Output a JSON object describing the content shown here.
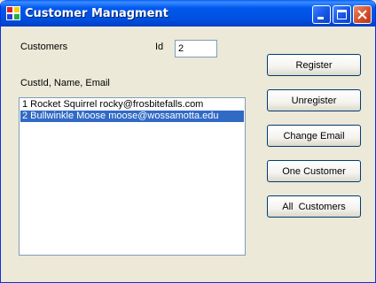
{
  "window": {
    "title": "Customer Managment"
  },
  "labels": {
    "customers": "Customers",
    "id": "Id",
    "columns": "CustId, Name, Email"
  },
  "id_field": {
    "value": "2"
  },
  "customers_list": {
    "items": [
      {
        "text": "1 Rocket Squirrel rocky@frosbitefalls.com",
        "selected": false
      },
      {
        "text": "2 Bullwinkle Moose moose@wossamotta.edu",
        "selected": true
      }
    ]
  },
  "buttons": {
    "register": "Register",
    "unregister": "Unregister",
    "change_email": "Change Email",
    "one_customer": "One Customer",
    "all_customers": "All  Customers"
  },
  "icons": {
    "app": "app-icon",
    "minimize": "minimize-icon",
    "maximize": "maximize-icon",
    "close": "close-icon"
  },
  "colors": {
    "titlebar": "#0058ee",
    "window_bg": "#ece9d8",
    "selection": "#316ac5",
    "close_button": "#d3502b"
  }
}
